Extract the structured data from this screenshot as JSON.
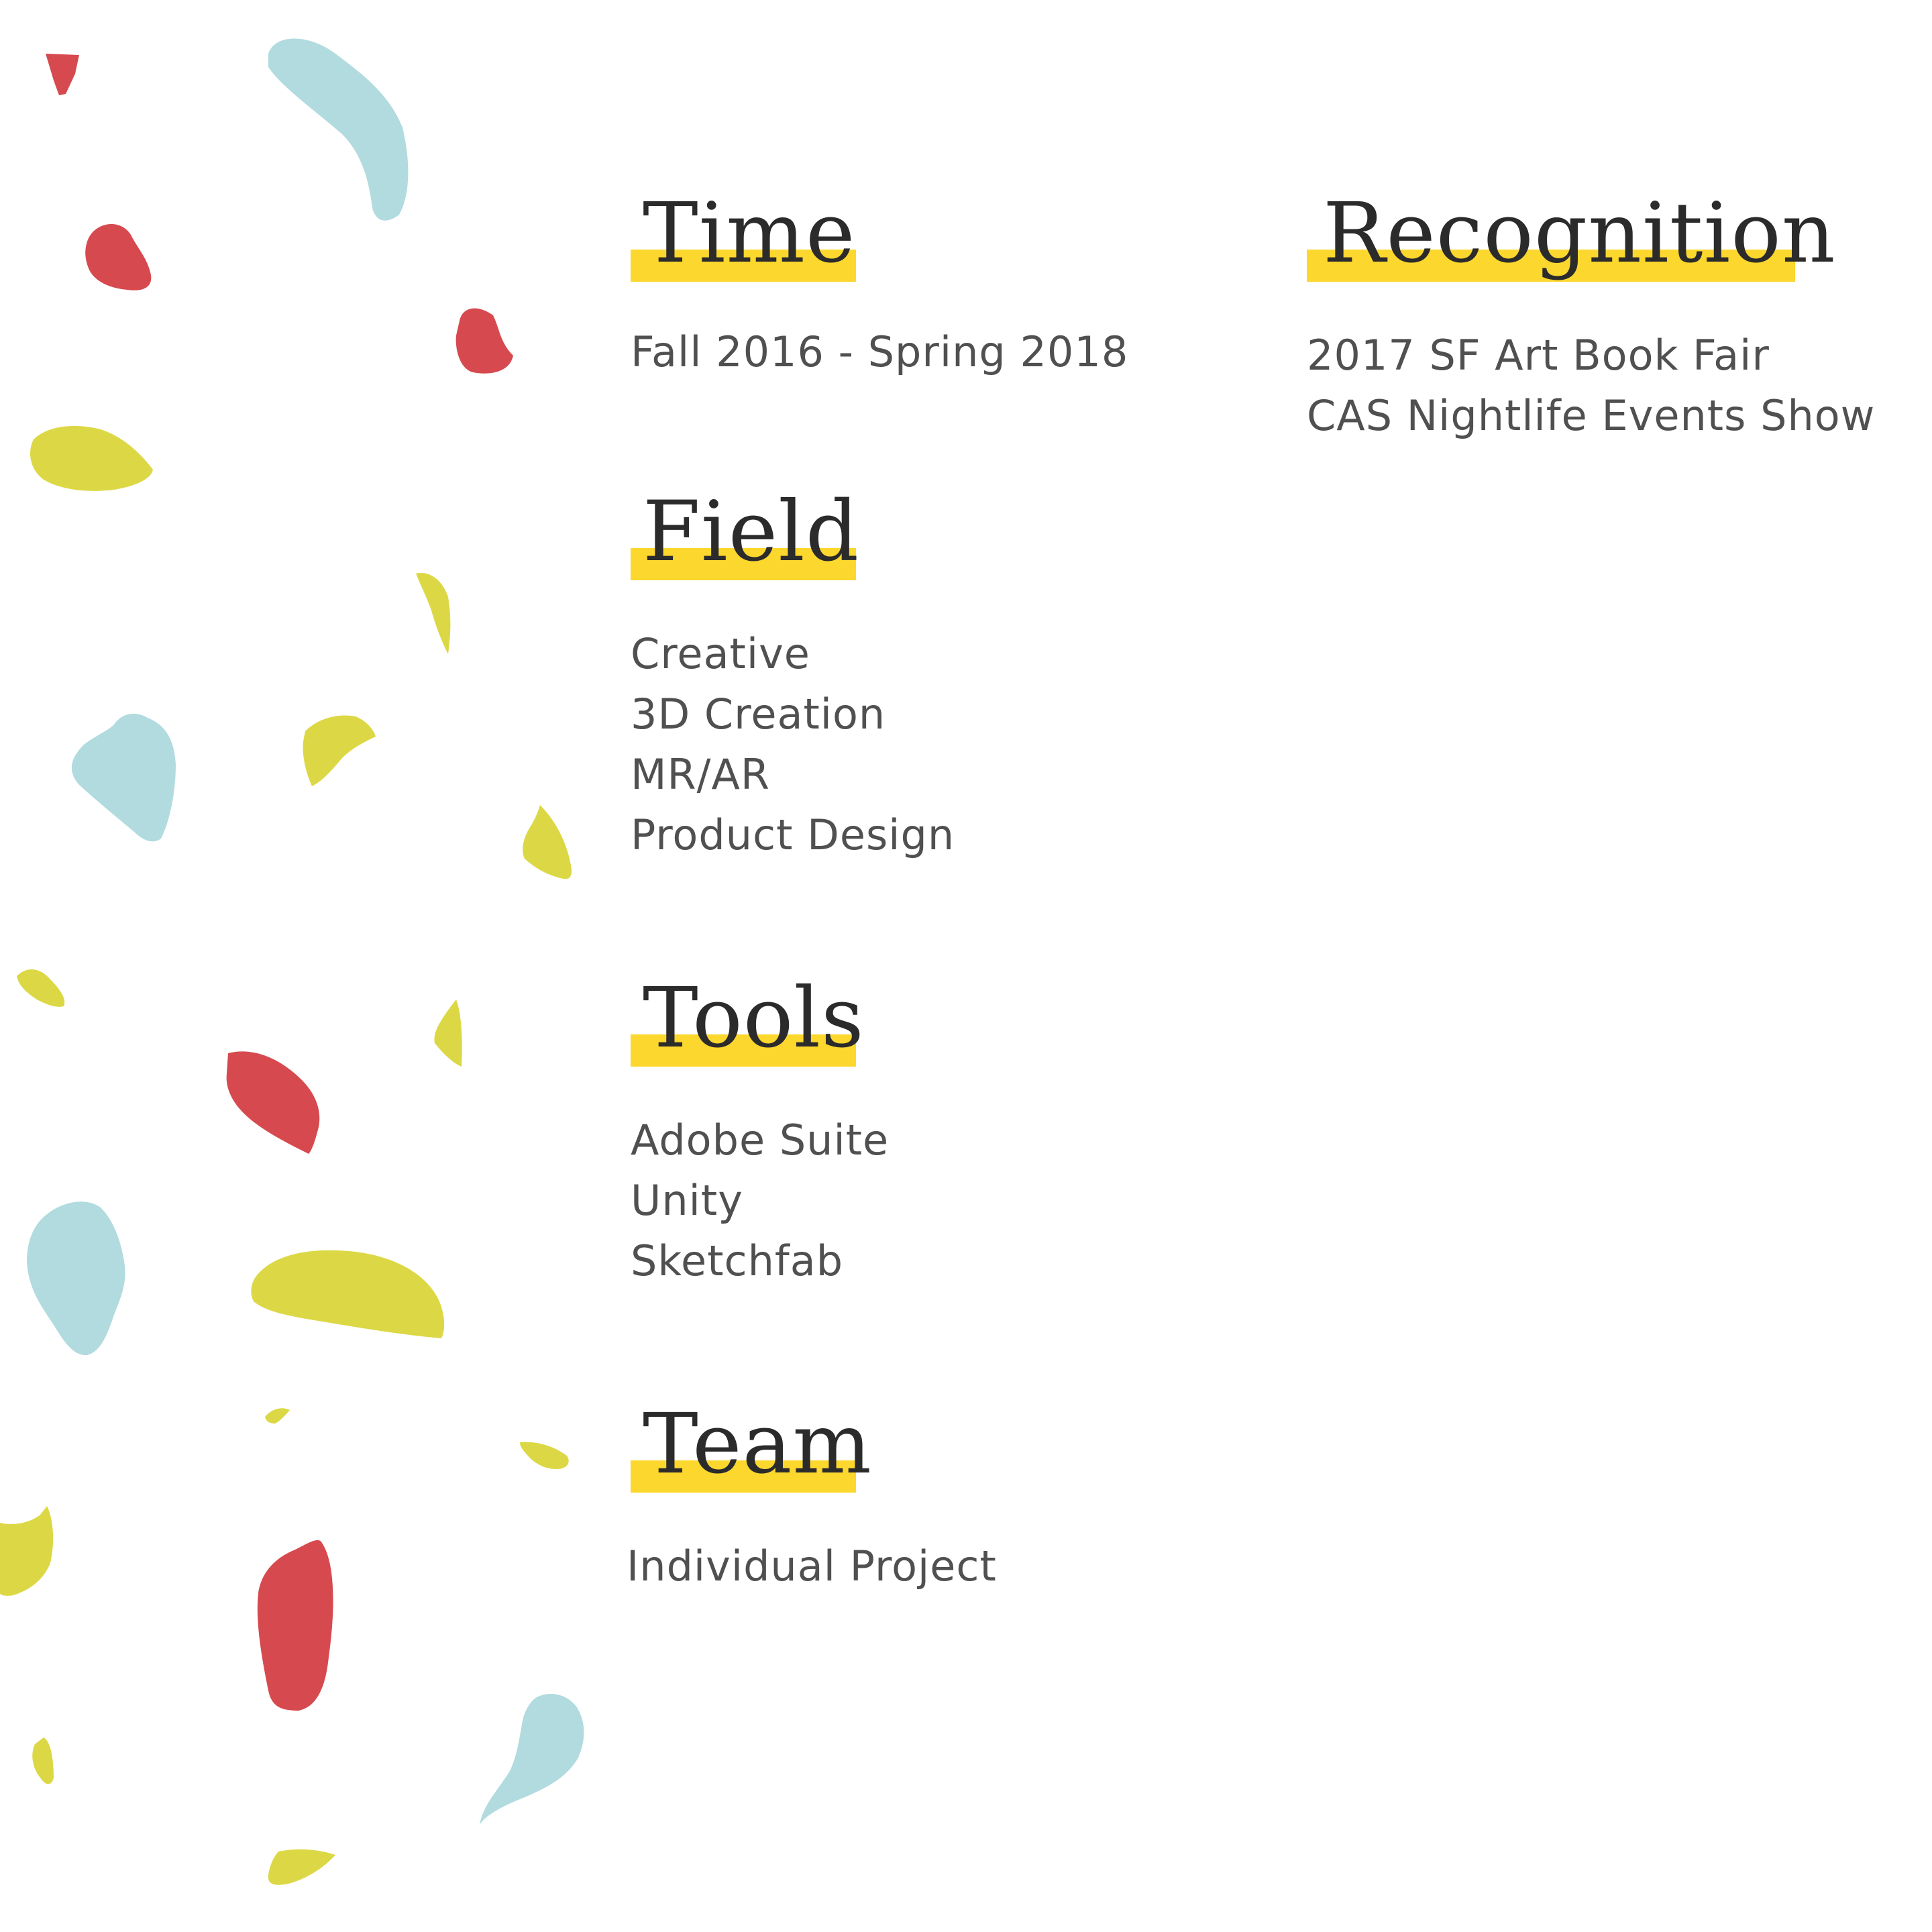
{
  "colors": {
    "highlight": "#fcd72e",
    "heading_text": "#2b2b2b",
    "body_text": "#505050",
    "confetti_blue": "#b1dbdf",
    "confetti_red": "#d64a4f",
    "confetti_yellow": "#dcd845"
  },
  "sections": {
    "time": {
      "title": "Time",
      "items": [
        "Fall 2016 - Spring 2018"
      ]
    },
    "field": {
      "title": "Field",
      "items": [
        "Creative",
        "3D Creation",
        "MR/AR",
        "Product Design"
      ]
    },
    "tools": {
      "title": "Tools",
      "items": [
        "Adobe Suite",
        "Unity",
        "Sketchfab"
      ]
    },
    "team": {
      "title": "Team",
      "items": [
        "Individual Project"
      ]
    },
    "recognition": {
      "title": "Recognition",
      "items": [
        "2017 SF Art Book Fair",
        "CAS Nightlife Events Show"
      ]
    }
  }
}
